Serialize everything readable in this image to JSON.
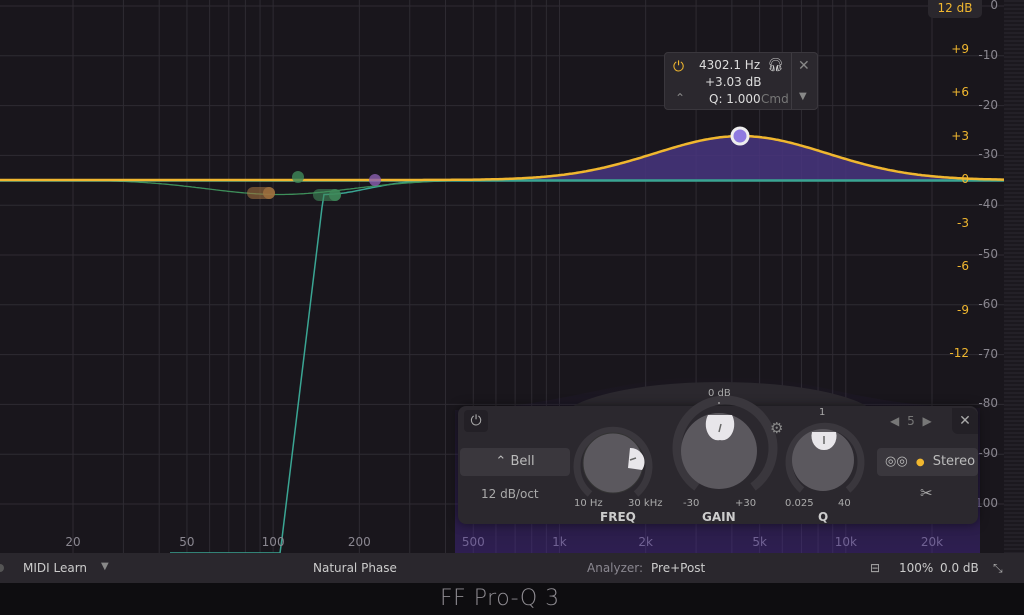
{
  "app": {
    "title": "FF Pro-Q 3"
  },
  "display": {
    "range_label": "12 dB",
    "eq_scale": [
      "+9",
      "+6",
      "+3",
      "0",
      "-3",
      "-6",
      "-9",
      "-12"
    ],
    "meter_scale": [
      "0",
      "-10",
      "-20",
      "-30",
      "-40",
      "-50",
      "-60",
      "-70",
      "-80",
      "-90",
      "-100"
    ],
    "freq_labels": [
      "20",
      "50",
      "100",
      "200",
      "500",
      "1k",
      "2k",
      "5k",
      "10k",
      "20k"
    ]
  },
  "band_popup": {
    "frequency": "4302.1 Hz",
    "gain": "+3.03 dB",
    "q": "Q: 1.000",
    "modifier_hint": "Cmd",
    "power_icon": "power-icon",
    "headphones_icon": "headphones-icon",
    "close_icon": "close-icon",
    "menu_icon": "dropdown-icon",
    "shape_icon": "bell-shape-icon"
  },
  "eq_bands": [
    {
      "index": 1,
      "type": "low-cut",
      "frequency_hz": 150,
      "color": "#3f8a5a"
    },
    {
      "index": 2,
      "type": "bell",
      "frequency_hz": 98,
      "gain_db": -1.0,
      "color": "#a0713f"
    },
    {
      "index": 3,
      "type": "bell",
      "frequency_hz": 120,
      "gain_db": 0.0,
      "color": "#3f8a5a"
    },
    {
      "index": 4,
      "type": "bell",
      "frequency_hz": 230,
      "gain_db": 0.0,
      "color": "#8a5fb0"
    },
    {
      "index": 5,
      "type": "bell",
      "frequency_hz": 4302.1,
      "gain_db": 3.03,
      "q": 1.0,
      "color": "#8f7ae0",
      "selected": true
    }
  ],
  "panel": {
    "shape_label": "Bell",
    "slope_label": "12 dB/oct",
    "freq": {
      "title": "FREQ",
      "min": "10 Hz",
      "max": "30 kHz"
    },
    "gain": {
      "title": "GAIN",
      "min": "-30",
      "max": "+30",
      "center": "0 dB"
    },
    "q": {
      "title": "Q",
      "min": "0.025",
      "max": "40",
      "center": "1"
    },
    "band_number": "5",
    "stereo_label": "Stereo"
  },
  "status_bar": {
    "midi_learn": "MIDI Learn",
    "phase_mode": "Natural Phase",
    "analyzer_label": "Analyzer:",
    "analyzer_value": "Pre+Post",
    "zoom": "100%",
    "output_gain": "0.0 dB"
  },
  "colors": {
    "accent": "#f0b72f",
    "selected_band": "#8f7ae0",
    "eq_fill": "#4a3580",
    "analyzer_curve": "#3aa593"
  }
}
